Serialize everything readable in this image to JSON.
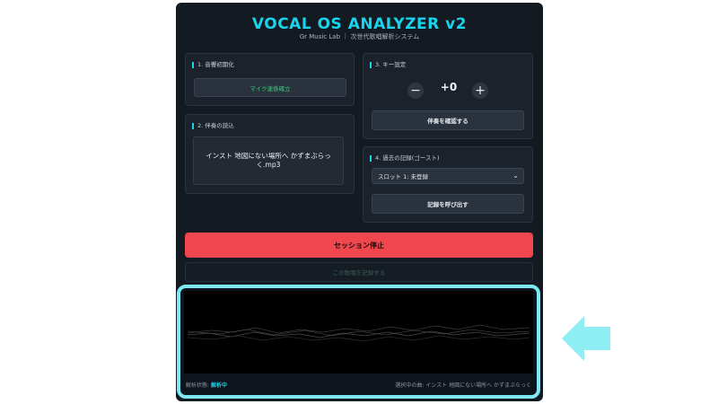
{
  "header": {
    "title": "VOCAL OS ANALYZER v2",
    "subtitle": "Gr Music Lab ｜ 次世代歌唱解析システム"
  },
  "sections": {
    "audio_init": {
      "label": "1. 音響初期化",
      "button": "マイク連係確立"
    },
    "track_load": {
      "label": "2. 伴奏の読込",
      "file_name": "インスト 地図にない場所へ かずまぶらっく.mp3"
    },
    "key_setting": {
      "label": "3. キー設定",
      "minus": "−",
      "value": "+0",
      "plus": "+",
      "confirm_button": "伴奏を確認する"
    },
    "history": {
      "label": "4. 過去の記録(ゴースト)",
      "selected_slot": "スロット 1: 未登録",
      "load_button": "記録を呼び出す"
    }
  },
  "actions": {
    "stop_session": "セッション停止",
    "record_take": "この歌唱を記録する"
  },
  "visualizer": {
    "status_label": "解析状態:",
    "status_value": "解析中",
    "now_playing": "選択中の曲: インスト 地図にない場所へ かずまぶらっく"
  },
  "colors": {
    "accent": "#18d3ec",
    "stop": "#f0464d",
    "highlight_frame": "#7de8f2",
    "arrow": "#8eeef4"
  },
  "icons": {
    "select_chevron": "chevron-down-icon",
    "pointer": "arrow-left-icon"
  }
}
